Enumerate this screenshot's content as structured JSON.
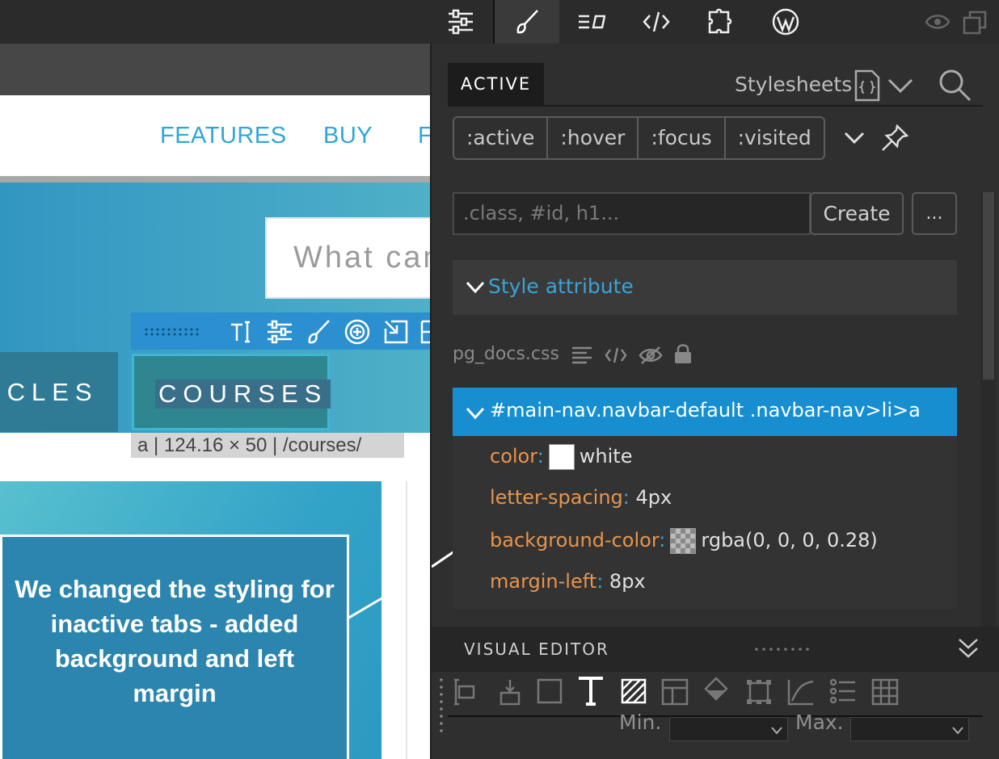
{
  "toolbar": {
    "items": [
      "settings",
      "style",
      "elements",
      "code",
      "plugins",
      "wordpress"
    ]
  },
  "canvas": {
    "nav_links": [
      "FEATURES",
      "BUY",
      "F"
    ],
    "search_placeholder": "What can",
    "tabs": [
      "ICLES",
      "COURSES"
    ],
    "element_info": "a | 124.16 × 50 | /courses/",
    "annotation": "We changed the styling for inactive tabs - added background and left margin"
  },
  "panel": {
    "active_tab": "ACTIVE",
    "stylesheets_label": "Stylesheets",
    "pseudo_states": [
      ":active",
      ":hover",
      ":focus",
      ":visited"
    ],
    "selector_placeholder": ".class, #id, h1...",
    "create_label": "Create",
    "more_label": "...",
    "style_attribute_label": "Style attribute",
    "stylesheet_file": "pg_docs.css",
    "rule": {
      "selector": "#main-nav.navbar-default .navbar-nav>li>a",
      "properties": [
        {
          "name": "color",
          "value": "white",
          "swatch": "#ffffff"
        },
        {
          "name": "letter-spacing",
          "value": "4px"
        },
        {
          "name": "background-color",
          "value": "rgba(0, 0, 0, 0.28)",
          "swatch": "checker"
        },
        {
          "name": "margin-left",
          "value": "8px"
        }
      ]
    },
    "visual_editor_label": "VISUAL EDITOR",
    "min_label": "Min.",
    "max_label": "Max."
  },
  "colors": {
    "accent_blue": "#168ed0",
    "property_orange": "#e8944c",
    "panel_bg": "#2f2f2f"
  }
}
